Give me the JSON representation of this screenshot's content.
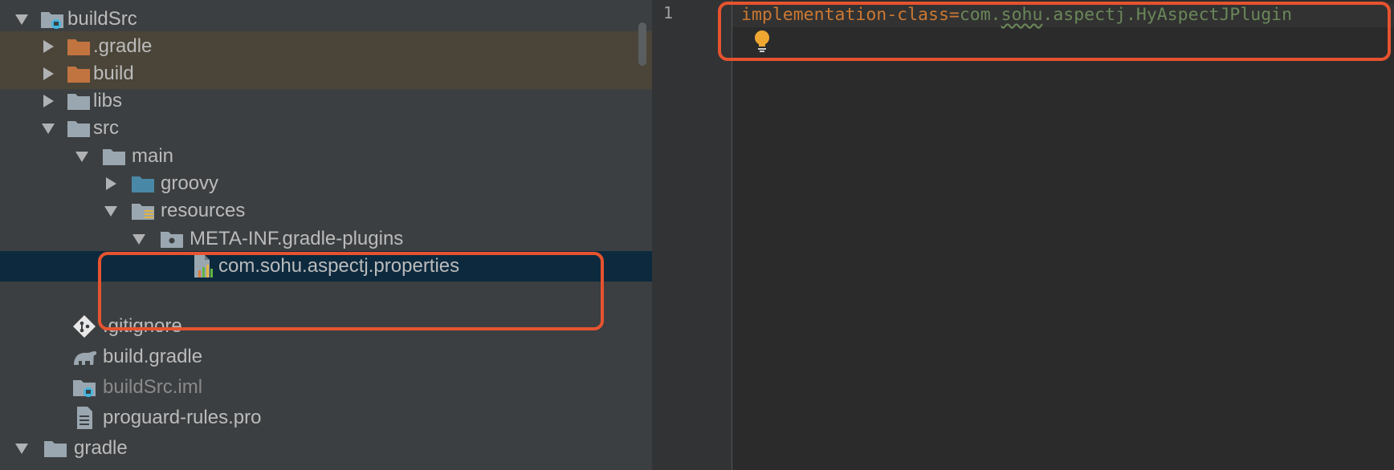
{
  "project_tree": {
    "items": [
      {
        "label": "buildSrc",
        "expanded": true,
        "icon": "module-folder-icon"
      },
      {
        "label": ".gradle",
        "expanded": false,
        "icon": "excluded-folder-icon"
      },
      {
        "label": "build",
        "expanded": false,
        "icon": "excluded-folder-icon"
      },
      {
        "label": "libs",
        "expanded": false,
        "icon": "folder-icon"
      },
      {
        "label": "src",
        "expanded": true,
        "icon": "folder-icon"
      },
      {
        "label": "main",
        "expanded": true,
        "icon": "folder-icon"
      },
      {
        "label": "groovy",
        "expanded": false,
        "icon": "source-folder-icon"
      },
      {
        "label": "resources",
        "expanded": true,
        "icon": "resources-folder-icon"
      },
      {
        "label": "META-INF.gradle-plugins",
        "expanded": true,
        "icon": "package-folder-icon"
      },
      {
        "label": "com.sohu.aspectj.properties",
        "icon": "properties-file-icon",
        "selected": true
      },
      {
        "label": ".gitignore",
        "icon": "git-file-icon"
      },
      {
        "label": "build.gradle",
        "icon": "gradle-file-icon"
      },
      {
        "label": "buildSrc.iml",
        "icon": "iml-file-icon"
      },
      {
        "label": "proguard-rules.pro",
        "icon": "text-file-icon"
      },
      {
        "label": "gradle",
        "expanded": true,
        "icon": "folder-icon"
      }
    ]
  },
  "editor": {
    "line_number": "1",
    "key": "implementation-class",
    "equals": "=",
    "value_pre": "com.",
    "value_typo": "sohu",
    "value_post": ".aspectj.HyAspectJPlugin",
    "intention_icon": "lightbulb-icon"
  },
  "colors": {
    "tree_background": "#3c3f41",
    "selected_row": "#0d293e",
    "excluded_row": "#4a4538",
    "editor_background": "#2b2b2b",
    "highlight_box": "#e6532f",
    "key_color": "#cc7832",
    "value_color": "#6a8759"
  }
}
